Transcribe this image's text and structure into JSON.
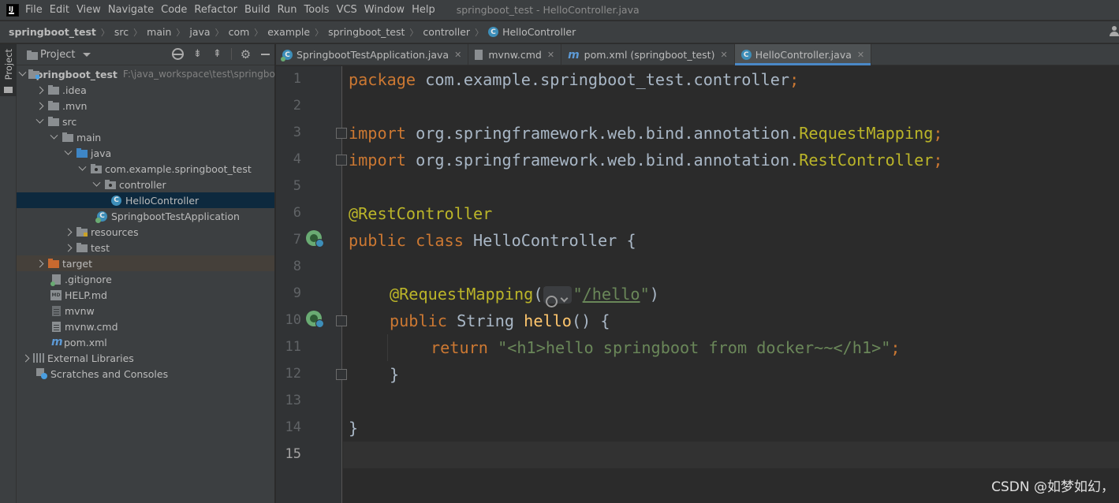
{
  "menubar": {
    "logo_text": "IJ",
    "items": [
      "File",
      "Edit",
      "View",
      "Navigate",
      "Code",
      "Refactor",
      "Build",
      "Run",
      "Tools",
      "VCS",
      "Window",
      "Help"
    ],
    "window_title": "springboot_test - HelloController.java"
  },
  "breadcrumb": {
    "items": [
      "springboot_test",
      "src",
      "main",
      "java",
      "com",
      "example",
      "springboot_test",
      "controller",
      "HelloController"
    ]
  },
  "toolstrip": {
    "project_label": "Project"
  },
  "project_panel": {
    "title": "Project",
    "tree": [
      {
        "label": "springboot_test",
        "path": "F:\\java_workspace\\test\\springbo",
        "depth": 0
      },
      {
        "label": ".idea",
        "depth": 1
      },
      {
        "label": ".mvn",
        "depth": 1
      },
      {
        "label": "src",
        "depth": 1
      },
      {
        "label": "main",
        "depth": 2
      },
      {
        "label": "java",
        "depth": 3
      },
      {
        "label": "com.example.springboot_test",
        "depth": 4
      },
      {
        "label": "controller",
        "depth": 5
      },
      {
        "label": "HelloController",
        "depth": 6
      },
      {
        "label": "SpringbootTestApplication",
        "depth": 5
      },
      {
        "label": "resources",
        "depth": 3
      },
      {
        "label": "test",
        "depth": 2
      },
      {
        "label": "target",
        "depth": 1
      },
      {
        "label": ".gitignore",
        "depth": 1
      },
      {
        "label": "HELP.md",
        "depth": 1
      },
      {
        "label": "mvnw",
        "depth": 1
      },
      {
        "label": "mvnw.cmd",
        "depth": 1
      },
      {
        "label": "pom.xml",
        "depth": 1
      },
      {
        "label": "External Libraries",
        "depth": 0
      },
      {
        "label": "Scratches and Consoles",
        "depth": 0
      }
    ]
  },
  "tabs": [
    {
      "label": "SpringbootTestApplication.java",
      "active": false
    },
    {
      "label": "mvnw.cmd",
      "active": false
    },
    {
      "label": "pom.xml (springboot_test)",
      "active": false
    },
    {
      "label": "HelloController.java",
      "active": true
    }
  ],
  "editor": {
    "line_numbers": [
      "1",
      "2",
      "3",
      "4",
      "5",
      "6",
      "7",
      "8",
      "9",
      "10",
      "11",
      "12",
      "13",
      "14",
      "15"
    ],
    "current_line": 15,
    "code": {
      "l1_kw": "package",
      "l1_rest": " com.example.springboot_test.controller",
      "l1_semi": ";",
      "l3_kw": "import",
      "l3_pkg": " org.springframework.web.bind.annotation.",
      "l3_cls": "RequestMapping",
      "l3_semi": ";",
      "l4_kw": "import",
      "l4_pkg": " org.springframework.web.bind.annotation.",
      "l4_cls": "RestController",
      "l4_semi": ";",
      "l6_ann": "@RestController",
      "l7_kw": "public class",
      "l7_rest": " HelloController {",
      "l9_ann": "@RequestMapping",
      "l9_open": "(",
      "l9_q1": "\"",
      "l9_url": "/hello",
      "l9_q2": "\"",
      "l9_close": ")",
      "l10_kw": "public",
      "l10_type": " String ",
      "l10_fn": "hello",
      "l10_rest": "() {",
      "l11_kw": "return",
      "l11_str": " \"<h1>hello springboot from docker~~</h1>\"",
      "l11_semi": ";",
      "l12": "}",
      "l14": "}"
    }
  },
  "watermark": "CSDN @如梦如幻，"
}
